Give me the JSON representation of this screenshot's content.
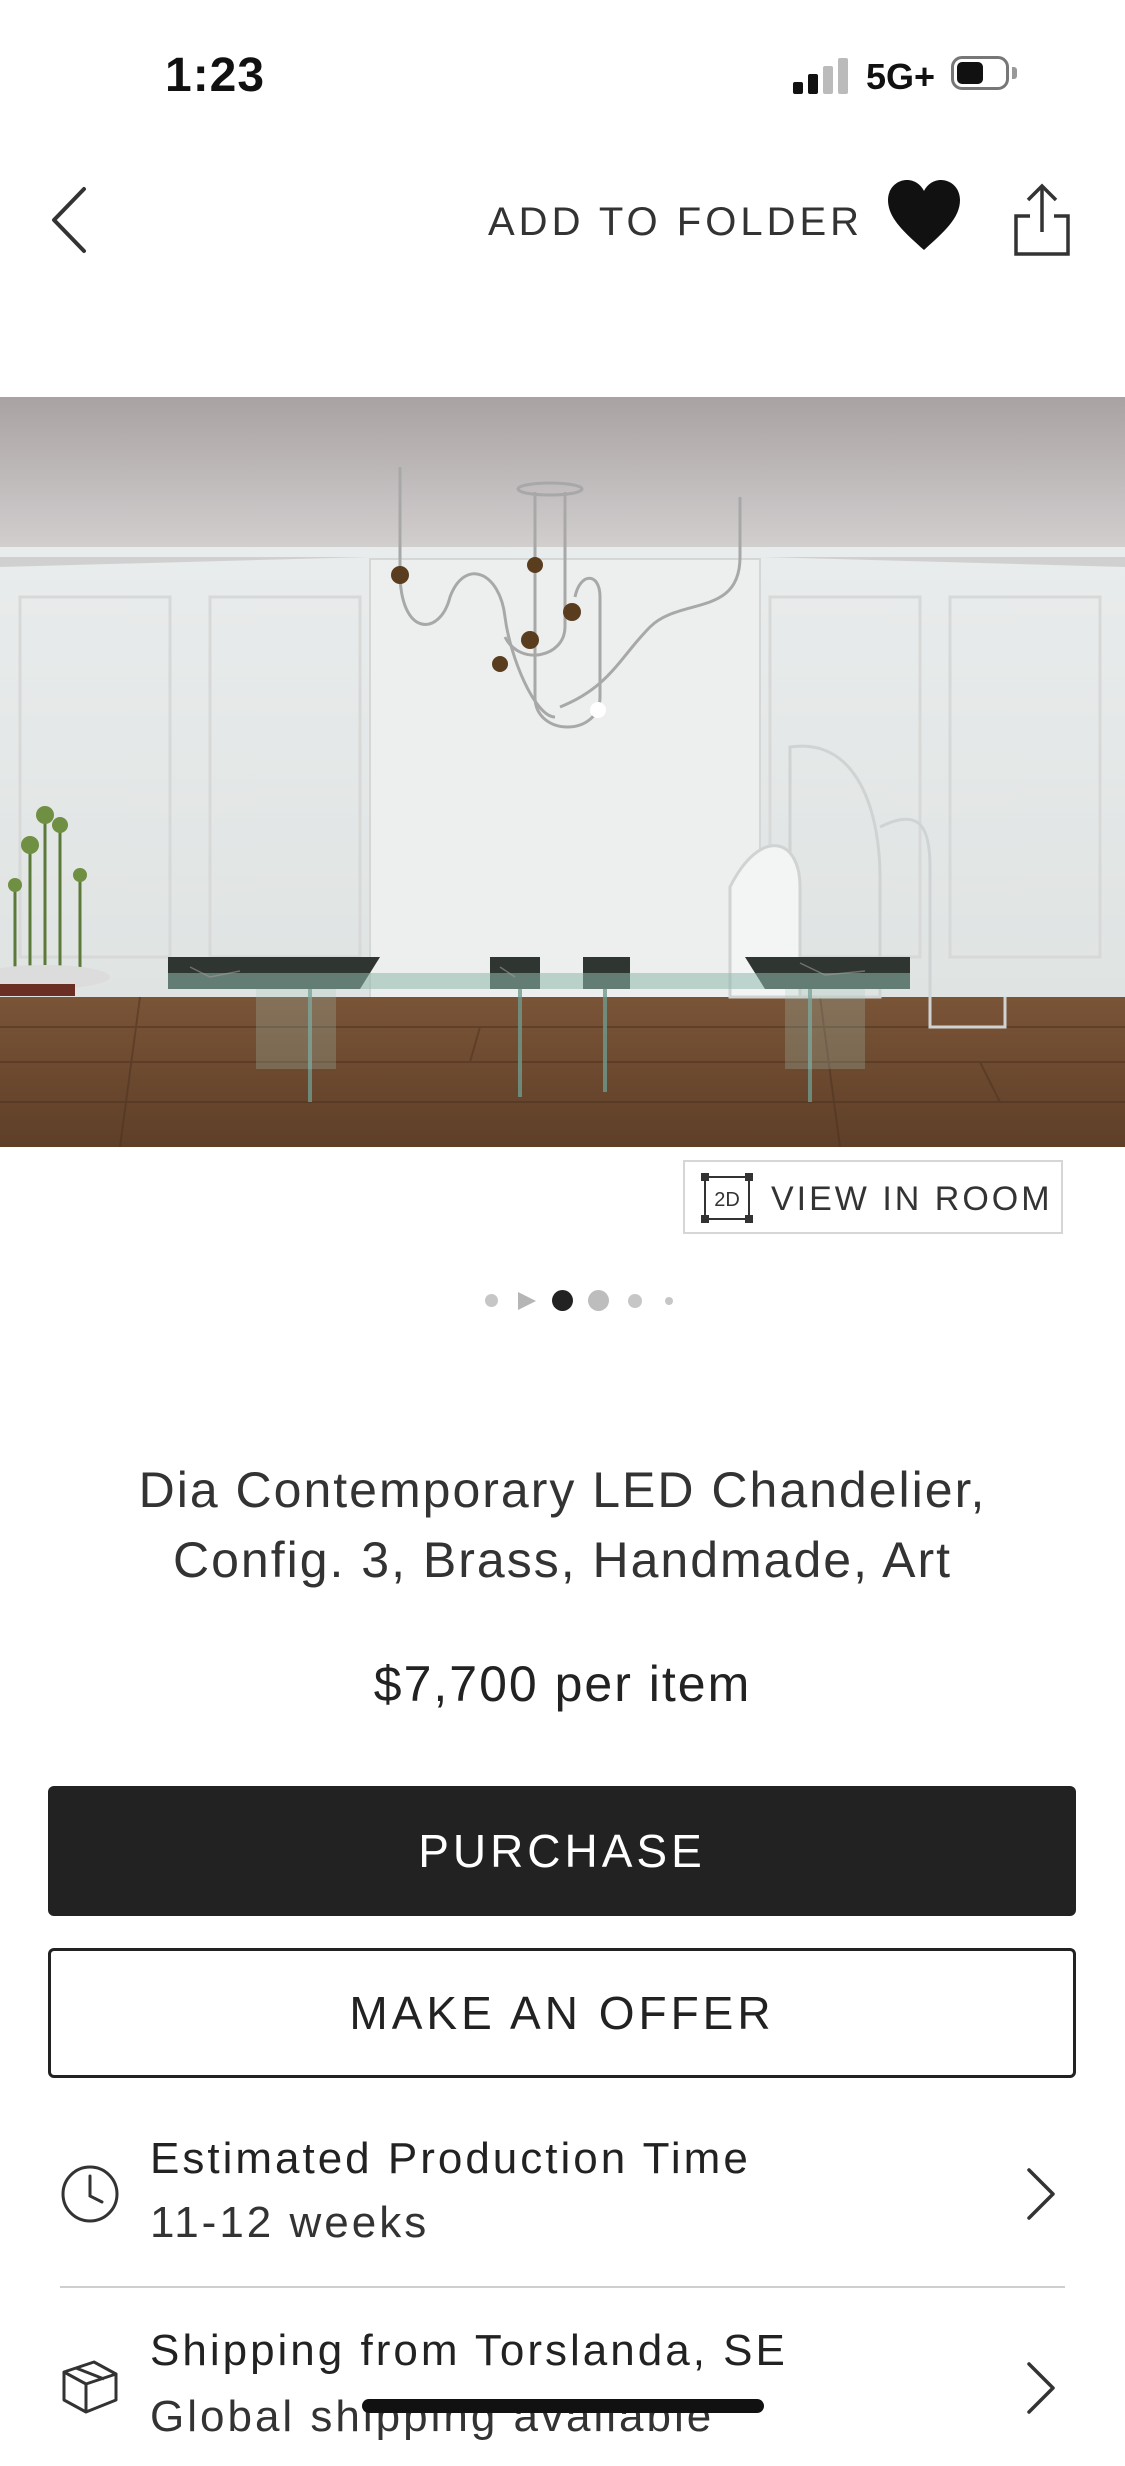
{
  "status_bar": {
    "time": "1:23",
    "network": "5G+",
    "signal_bars_active": 2,
    "signal_bars_total": 4,
    "battery_level": 0.45
  },
  "nav": {
    "back_icon": "chevron-left-icon",
    "add_to_folder_label": "ADD TO FOLDER",
    "favorite_icon": "heart-icon",
    "share_icon": "share-icon"
  },
  "gallery": {
    "view_in_room_badge": "2D",
    "view_in_room_label": "VIEW IN ROOM",
    "total_items": 6,
    "active_index": 2
  },
  "product": {
    "title_line1": "Dia Contemporary LED Chandelier,",
    "title_line2": "Config. 3, Brass, Handmade, Art",
    "price": "$7,700 per item"
  },
  "actions": {
    "purchase_label": "PURCHASE",
    "offer_label": "MAKE AN OFFER"
  },
  "details": [
    {
      "icon": "clock-icon",
      "heading": "Estimated Production Time",
      "sub": "11-12 weeks"
    },
    {
      "icon": "package-icon",
      "heading": "Shipping from Torslanda, SE",
      "sub": "Global shipping available"
    }
  ],
  "colors": {
    "primary": "#222222",
    "divider": "#cfcfcf"
  }
}
